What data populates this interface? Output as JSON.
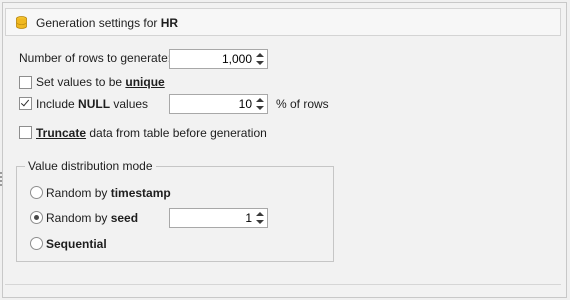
{
  "header": {
    "prefix": "Generation settings for",
    "table": "HR"
  },
  "rows": {
    "label": "Number of rows to generate:",
    "value": "1,000"
  },
  "unique": {
    "label_pre": "Set values to be ",
    "label_bold": "unique",
    "checked": false
  },
  "nulls": {
    "label_pre": "Include ",
    "label_bold": "NULL",
    "label_post": " values",
    "checked": true,
    "value": "10",
    "suffix": "% of rows"
  },
  "truncate": {
    "label_bold": "Truncate",
    "label_post": " data from table before generation",
    "checked": false
  },
  "distribution": {
    "title": "Value distribution mode",
    "options": [
      {
        "pre": "Random by ",
        "bold": "timestamp",
        "selected": false
      },
      {
        "pre": "Random by ",
        "bold": "seed",
        "selected": true,
        "value": "1"
      },
      {
        "pre": "",
        "bold": "Sequential",
        "selected": false
      }
    ]
  },
  "icons": {
    "db": "database-icon",
    "spin": "spin-arrows-icon"
  }
}
